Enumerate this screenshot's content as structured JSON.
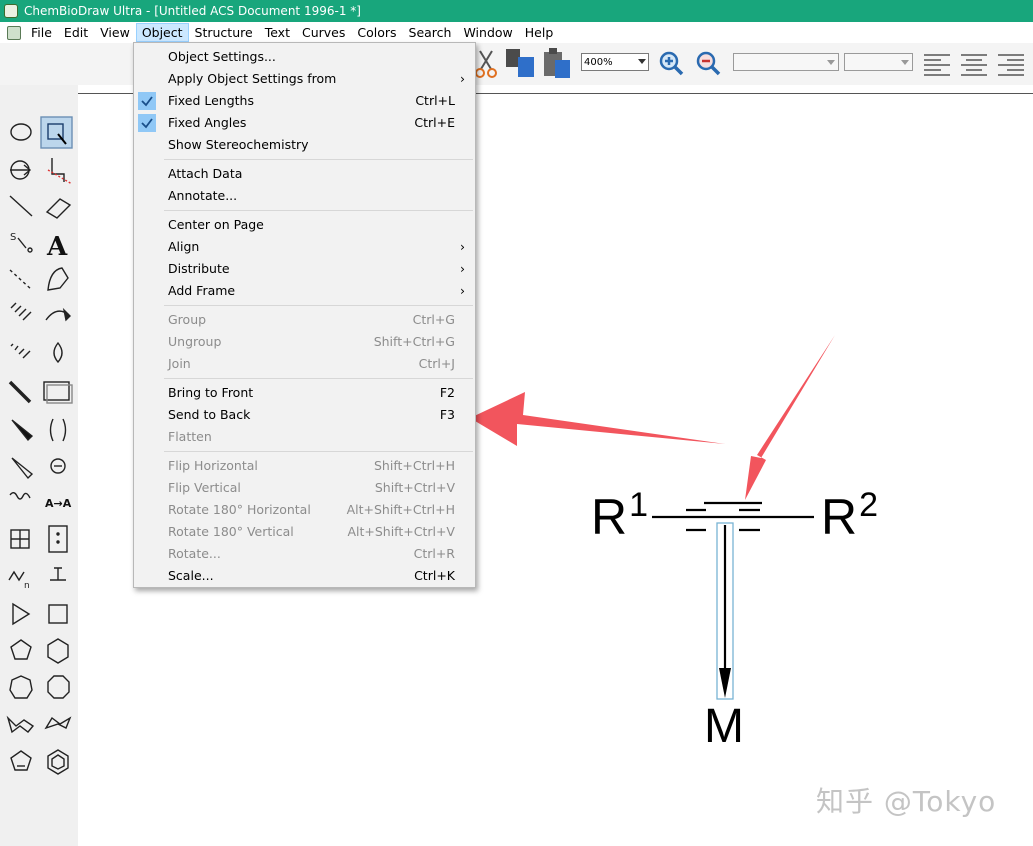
{
  "window": {
    "title": "ChemBioDraw Ultra - [Untitled ACS Document 1996-1 *]"
  },
  "menubar": {
    "items": [
      "File",
      "Edit",
      "View",
      "Object",
      "Structure",
      "Text",
      "Curves",
      "Colors",
      "Search",
      "Window",
      "Help"
    ],
    "active": "Object"
  },
  "toolbar": {
    "zoom_value": "400%"
  },
  "object_menu": {
    "items": [
      {
        "label": "Object Settings...",
        "shortcut": "",
        "submenu": false,
        "checked": false,
        "disabled": false
      },
      {
        "label": "Apply Object Settings from",
        "shortcut": "",
        "submenu": true,
        "checked": false,
        "disabled": false
      },
      {
        "label": "Fixed Lengths",
        "shortcut": "Ctrl+L",
        "submenu": false,
        "checked": true,
        "disabled": false
      },
      {
        "label": "Fixed Angles",
        "shortcut": "Ctrl+E",
        "submenu": false,
        "checked": true,
        "disabled": false
      },
      {
        "label": "Show Stereochemistry",
        "shortcut": "",
        "submenu": false,
        "checked": false,
        "disabled": false
      },
      {
        "label": "Attach Data",
        "shortcut": "",
        "submenu": false,
        "checked": false,
        "disabled": false
      },
      {
        "label": "Annotate...",
        "shortcut": "",
        "submenu": false,
        "checked": false,
        "disabled": false
      },
      {
        "label": "Center on Page",
        "shortcut": "",
        "submenu": false,
        "checked": false,
        "disabled": false
      },
      {
        "label": "Align",
        "shortcut": "",
        "submenu": true,
        "checked": false,
        "disabled": false
      },
      {
        "label": "Distribute",
        "shortcut": "",
        "submenu": true,
        "checked": false,
        "disabled": false
      },
      {
        "label": "Add Frame",
        "shortcut": "",
        "submenu": true,
        "checked": false,
        "disabled": false
      },
      {
        "label": "Group",
        "shortcut": "Ctrl+G",
        "submenu": false,
        "checked": false,
        "disabled": true
      },
      {
        "label": "Ungroup",
        "shortcut": "Shift+Ctrl+G",
        "submenu": false,
        "checked": false,
        "disabled": true
      },
      {
        "label": "Join",
        "shortcut": "Ctrl+J",
        "submenu": false,
        "checked": false,
        "disabled": true
      },
      {
        "label": "Bring to Front",
        "shortcut": "F2",
        "submenu": false,
        "checked": false,
        "disabled": false
      },
      {
        "label": "Send to Back",
        "shortcut": "F3",
        "submenu": false,
        "checked": false,
        "disabled": false
      },
      {
        "label": "Flatten",
        "shortcut": "",
        "submenu": false,
        "checked": false,
        "disabled": true
      },
      {
        "label": "Flip Horizontal",
        "shortcut": "Shift+Ctrl+H",
        "submenu": false,
        "checked": false,
        "disabled": true
      },
      {
        "label": "Flip Vertical",
        "shortcut": "Shift+Ctrl+V",
        "submenu": false,
        "checked": false,
        "disabled": true
      },
      {
        "label": "Rotate 180° Horizontal",
        "shortcut": "Alt+Shift+Ctrl+H",
        "submenu": false,
        "checked": false,
        "disabled": true
      },
      {
        "label": "Rotate 180° Vertical",
        "shortcut": "Alt+Shift+Ctrl+V",
        "submenu": false,
        "checked": false,
        "disabled": true
      },
      {
        "label": "Rotate...",
        "shortcut": "Ctrl+R",
        "submenu": false,
        "checked": false,
        "disabled": true
      },
      {
        "label": "Scale...",
        "shortcut": "Ctrl+K",
        "submenu": false,
        "checked": false,
        "disabled": false
      }
    ]
  },
  "drawing": {
    "r1_base": "R",
    "r1_sup": "1",
    "r2_base": "R",
    "r2_sup": "2",
    "metal": "M"
  },
  "palette": {
    "tools": [
      "lasso-tool-icon",
      "marquee-select-tool-icon",
      "structure-perspective-icon",
      "mass-fragmentation-icon",
      "solid-bond-icon",
      "eraser-icon",
      "chain-tool-icon",
      "text-tool-icon",
      "dashed-bond-icon",
      "pen-tool-icon",
      "hashed-bond-icon",
      "arrow-tool-icon",
      "hashed-wedge-bond-icon",
      "orbital-tool-icon",
      "bold-bond-icon",
      "drawing-elements-icon",
      "wedge-bond-icon",
      "brackets-icon",
      "hollow-wedge-bond-icon",
      "chemical-symbols-icon",
      "wavy-bond-icon",
      "query-tool-icon",
      "table-tool-icon",
      "tlc-plate-icon",
      "acyclic-chain-icon",
      "templates-icon",
      "triangle-ring-icon",
      "square-ring-icon",
      "pentagon-ring-icon",
      "hexagon-ring-icon",
      "heptagon-ring-icon",
      "octagon-ring-icon",
      "cyclohexane-chair-1-icon",
      "cyclohexane-chair-2-icon",
      "cyclopentadiene-icon",
      "benzene-icon"
    ]
  },
  "watermark": {
    "text": "知乎 @Tokyo"
  },
  "colors": {
    "titlebar": "#18a67c",
    "menu_highlight": "#cce8ff",
    "annotation_arrow": "#f2555d",
    "check_bg": "#90c8f6"
  }
}
